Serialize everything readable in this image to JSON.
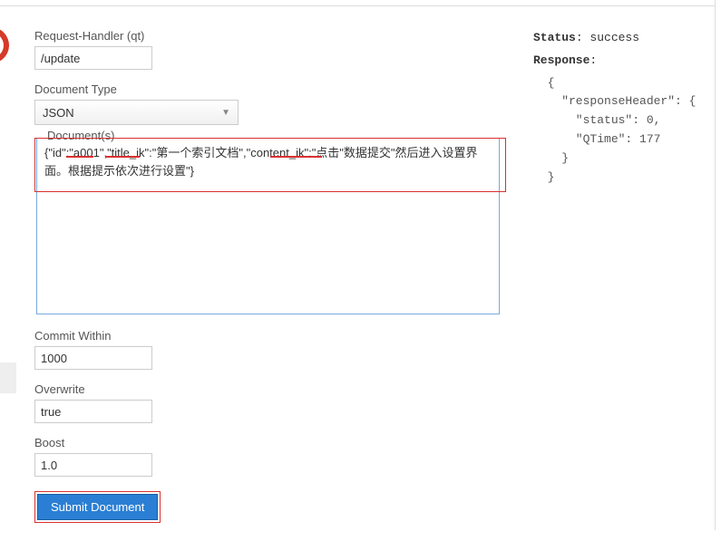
{
  "form": {
    "request_handler": {
      "label": "Request-Handler (qt)",
      "value": "/update"
    },
    "document_type": {
      "label": "Document Type",
      "value": "JSON"
    },
    "documents": {
      "label": "Document(s)",
      "value": "{\"id\":\"a001\",\"title_ik\":\"第一个索引文档\",\"content_ik\":\"点击\"数据提交\"然后进入设置界面。根据提示依次进行设置\"}"
    },
    "commit_within": {
      "label": "Commit Within",
      "value": "1000"
    },
    "overwrite": {
      "label": "Overwrite",
      "value": "true"
    },
    "boost": {
      "label": "Boost",
      "value": "1.0"
    },
    "submit_label": "Submit Document"
  },
  "response": {
    "status_label": "Status",
    "status_value": "success",
    "response_label": "Response",
    "json": "{\n  \"responseHeader\": {\n    \"status\": 0,\n    \"QTime\": 177\n  }\n}"
  }
}
